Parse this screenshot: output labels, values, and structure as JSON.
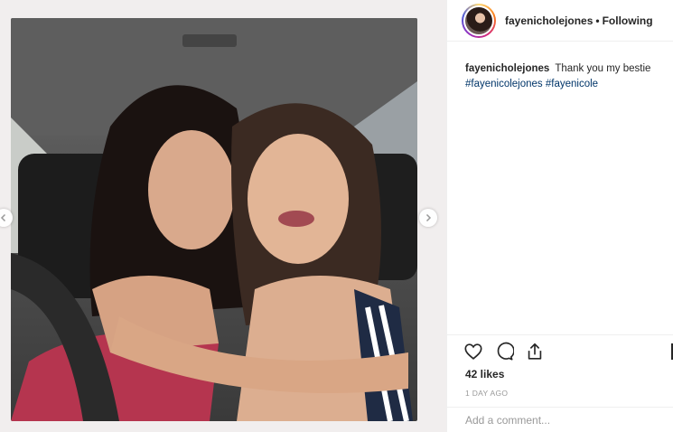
{
  "post": {
    "username": "fayenicholejones",
    "separator": "•",
    "follow_status": "Following",
    "caption": {
      "username": "fayenicholejones",
      "text": "Thank you my bestie",
      "hashtags": [
        "#fayenicolejones",
        "#fayenicole"
      ]
    },
    "likes": "42 likes",
    "timestamp": "1 DAY AGO",
    "comment_placeholder": "Add a comment..."
  },
  "icons": {
    "like": "heart-icon",
    "comment": "comment-icon",
    "share": "share-icon",
    "prev": "chevron-left-icon",
    "next": "chevron-right-icon"
  },
  "colors": {
    "hashtag": "#003569",
    "text": "#262626",
    "muted": "#999999",
    "border": "#efefef"
  }
}
